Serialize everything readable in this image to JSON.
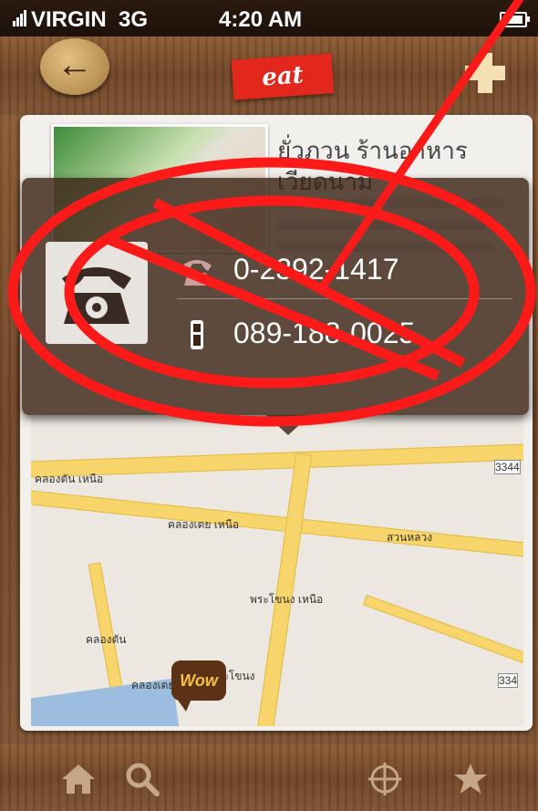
{
  "status_bar": {
    "carrier": "VIRGIN",
    "network": "3G",
    "time": "4:20 AM"
  },
  "nav": {
    "section_tag": "eat",
    "back_icon": "arrow-left-icon",
    "add_icon": "plus-icon"
  },
  "restaurant": {
    "name": "ยั่วภวน ร้านอาหาร เวียดนาม"
  },
  "contact_popup": {
    "phone_icon": "telephone-icon",
    "phone": "0-2392-1417",
    "mobile": "089-188-0025"
  },
  "map": {
    "pin_label": "Wow",
    "labels": [
      "คลองตัน เหนือ",
      "คลองเตย เหนือ",
      "สวนหลวง",
      "พระโขนง เหนือ",
      "คลองตัน",
      "คลองเตย",
      "พระโขนง",
      "3344",
      "334"
    ]
  },
  "tabs": [
    {
      "icon": "home-icon"
    },
    {
      "icon": "search-icon"
    },
    {
      "icon": "locate-icon"
    },
    {
      "icon": "star-icon"
    }
  ],
  "colors": {
    "prohibition_red": "#ff1a1a",
    "section_tag_red": "#e2271d",
    "wood_brown": "#6e4425"
  }
}
